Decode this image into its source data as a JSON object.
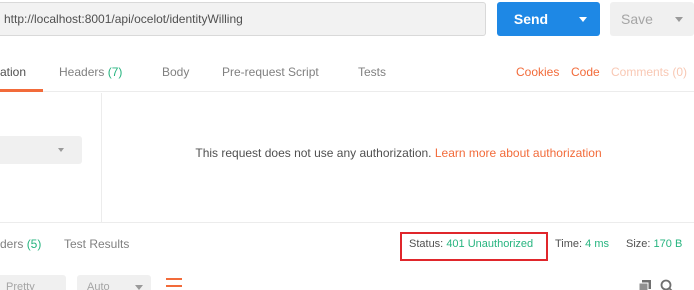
{
  "request": {
    "url": "http://localhost:8001/api/ocelot/identityWilling",
    "send_label": "Send",
    "save_label": "Save"
  },
  "request_tabs": {
    "authorization": "ation",
    "headers": "Headers",
    "headers_count": "(7)",
    "body": "Body",
    "pre_request_script": "Pre-request Script",
    "tests": "Tests",
    "cookies": "Cookies",
    "code": "Code",
    "comments": "Comments (0)"
  },
  "auth": {
    "message": "This request does not use any authorization.",
    "learn_more": "Learn more about authorization"
  },
  "response": {
    "headers_tab": "ders",
    "headers_count": "(5)",
    "test_results_tab": "Test Results",
    "status_label": "Status:",
    "status_value": "401 Unauthorized",
    "time_label": "Time:",
    "time_value": "4 ms",
    "size_label": "Size:",
    "size_value": "170 B"
  },
  "response_toolbar": {
    "pretty_label": "Pretty",
    "format_label": "Auto"
  },
  "colors": {
    "send_blue": "#1e88e5",
    "accent_orange": "#f26b3a",
    "status_green": "#26b47f",
    "highlight_red": "#e0262b"
  },
  "icons": [
    "chevron-down-icon",
    "wrap-lines-icon",
    "copy-icon",
    "search-icon"
  ]
}
